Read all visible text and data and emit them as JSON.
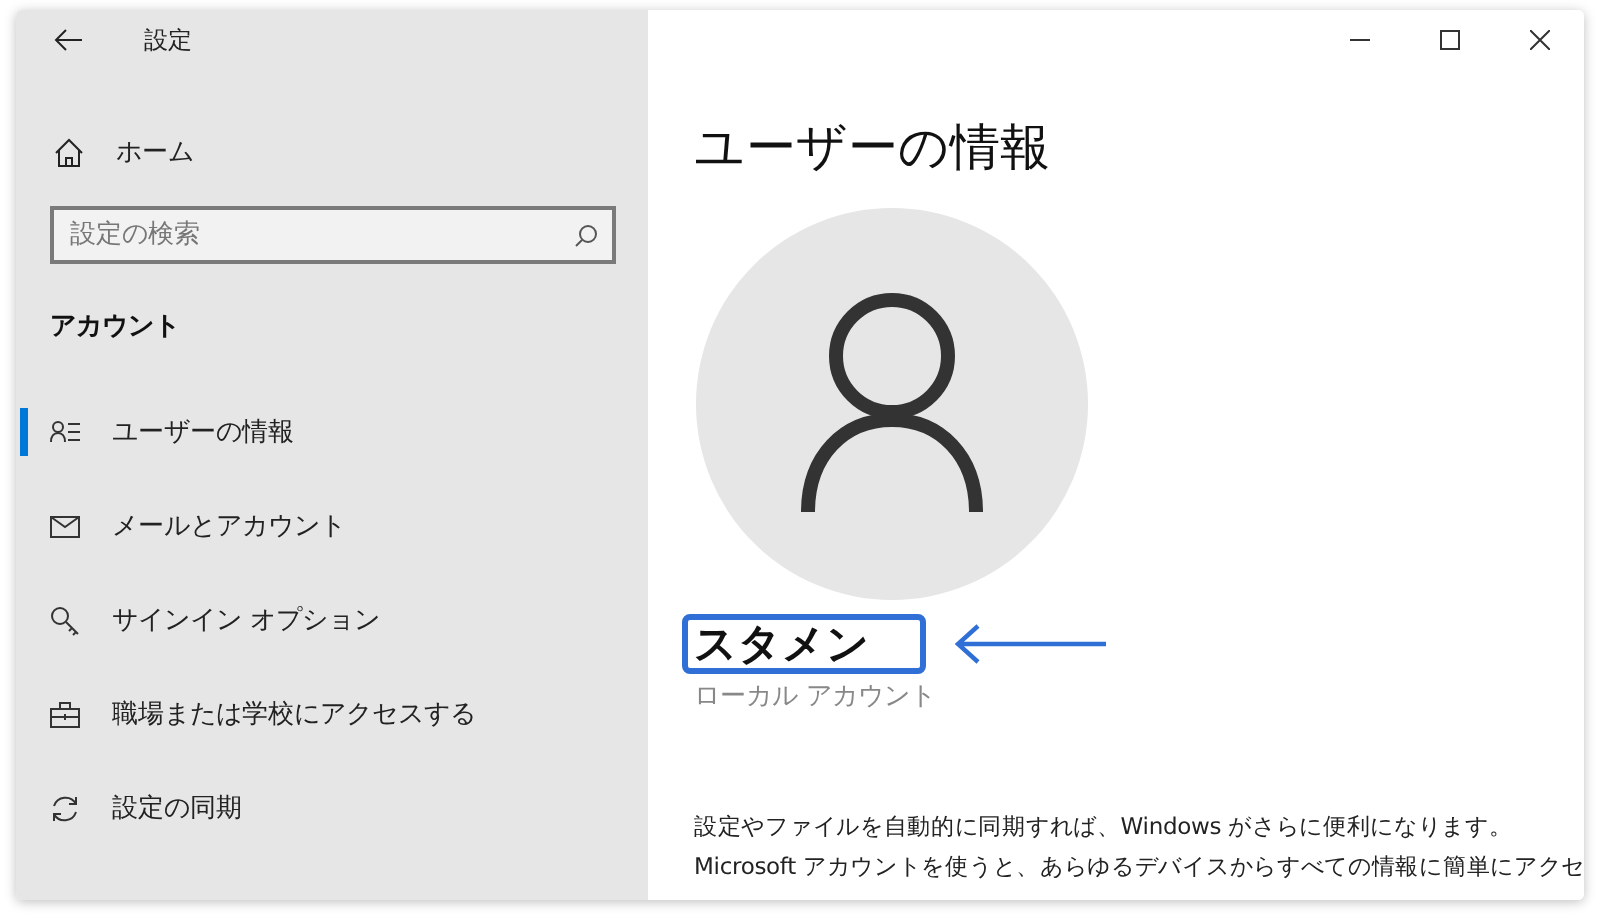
{
  "window": {
    "title": "設定"
  },
  "sidebar": {
    "home": "ホーム",
    "search": {
      "placeholder": "設定の検索"
    },
    "section": "アカウント",
    "items": [
      {
        "label": "ユーザーの情報",
        "selected": true
      },
      {
        "label": "メールとアカウント",
        "selected": false
      },
      {
        "label": "サインイン オプション",
        "selected": false
      },
      {
        "label": "職場または学校にアクセスする",
        "selected": false
      },
      {
        "label": "設定の同期",
        "selected": false
      }
    ]
  },
  "main": {
    "title": "ユーザーの情報",
    "user": {
      "name": "スタメン",
      "highlighted": true,
      "account_type": "ローカル アカウント"
    },
    "paragraph_lines": [
      "設定やファイルを自動的に同期すれば、Windows がさらに便利になります。",
      "Microsoft アカウントを使うと、あらゆるデバイスからすべての情報に簡単にアクセ"
    ]
  }
}
